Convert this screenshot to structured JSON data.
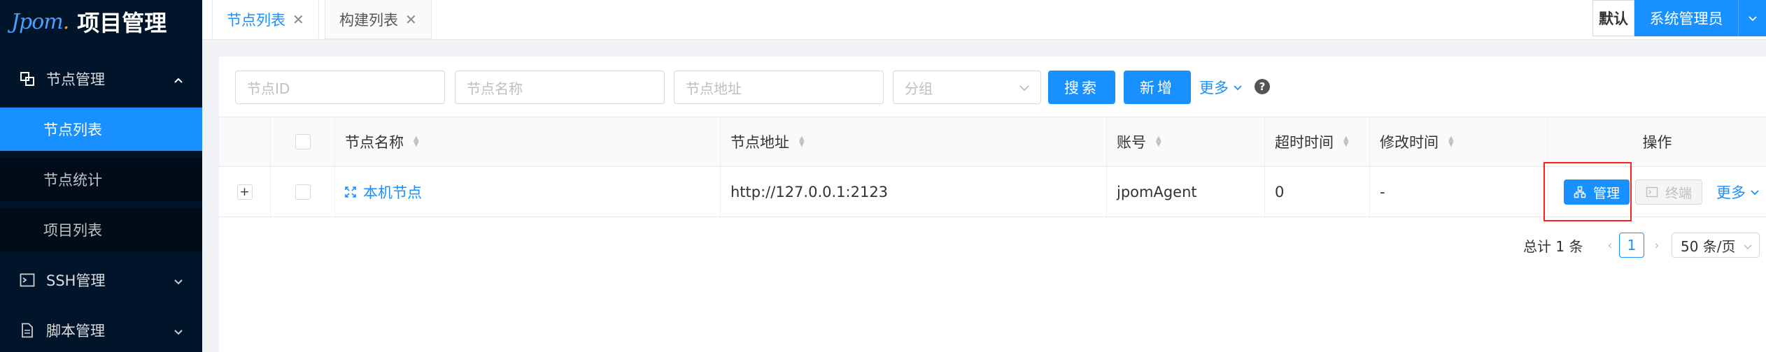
{
  "app": {
    "logo_text": "Jpom",
    "title": "项目管理"
  },
  "sidebar": {
    "groups": [
      {
        "label": "节点管理",
        "icon": "node-manage-icon",
        "expanded": true
      },
      {
        "label": "SSH管理",
        "icon": "terminal-icon",
        "expanded": false
      },
      {
        "label": "脚本管理",
        "icon": "file-icon",
        "expanded": false
      }
    ],
    "items": [
      {
        "label": "节点列表",
        "active": true
      },
      {
        "label": "节点统计",
        "active": false
      },
      {
        "label": "项目列表",
        "active": false
      }
    ]
  },
  "tabs": [
    {
      "label": "节点列表",
      "active": true
    },
    {
      "label": "构建列表",
      "active": false
    }
  ],
  "user": {
    "workspace": "默认",
    "name": "系统管理员"
  },
  "filters": {
    "node_id_placeholder": "节点ID",
    "node_name_placeholder": "节点名称",
    "node_address_placeholder": "节点地址",
    "group_placeholder": "分组",
    "search_label": "搜索",
    "add_label": "新增",
    "more_label": "更多",
    "help_symbol": "?"
  },
  "table": {
    "columns": [
      "节点名称",
      "节点地址",
      "账号",
      "超时时间",
      "修改时间",
      "操作"
    ],
    "rows": [
      {
        "name": "本机节点",
        "address": "http://127.0.0.1:2123",
        "account": "jpomAgent",
        "timeout": "0",
        "modified": "-",
        "actions": {
          "manage": "管理",
          "terminal": "终端",
          "more": "更多"
        }
      }
    ]
  },
  "pagination": {
    "total_text": "总计 1 条",
    "current_page": "1",
    "page_size": "50 条/页"
  },
  "colors": {
    "primary": "#1890ff",
    "sidebar_bg": "#001529",
    "highlight": "#ff1f1f"
  }
}
